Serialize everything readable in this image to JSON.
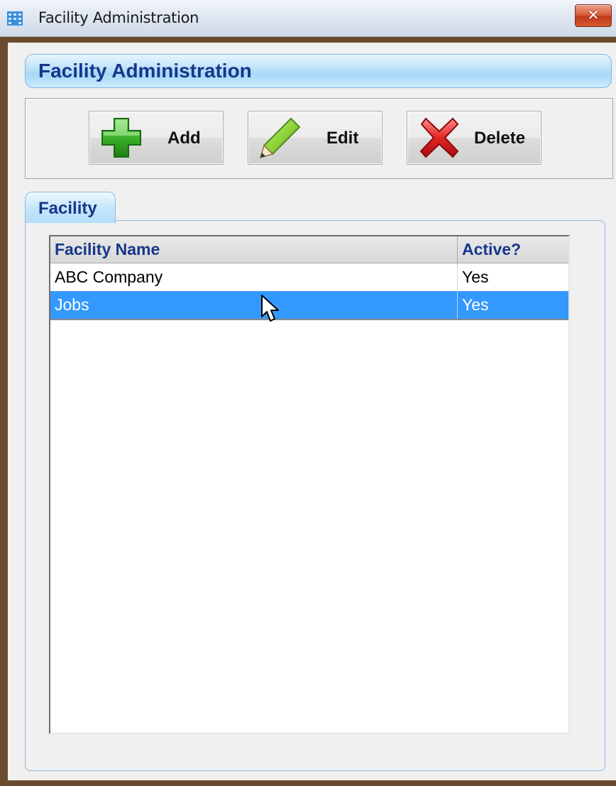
{
  "window": {
    "title": "Facility Administration",
    "close_glyph": "✕",
    "icon": "facility-app-icon"
  },
  "header": {
    "title": "Facility Administration"
  },
  "toolbar": {
    "add_label": "Add",
    "add_icon": "plus-icon",
    "edit_label": "Edit",
    "edit_icon": "pencil-icon",
    "delete_label": "Delete",
    "delete_icon": "red-x-icon"
  },
  "tabs": [
    {
      "label": "Facility",
      "active": true
    }
  ],
  "grid": {
    "columns": [
      "Facility Name",
      "Active?"
    ],
    "rows": [
      {
        "name": "ABC Company",
        "active": "Yes",
        "selected": false
      },
      {
        "name": "Jobs",
        "active": "Yes",
        "selected": true
      }
    ]
  },
  "colors": {
    "header_text": "#17378a",
    "selection": "#3399ff",
    "window_frame": "#6b4a2e"
  }
}
